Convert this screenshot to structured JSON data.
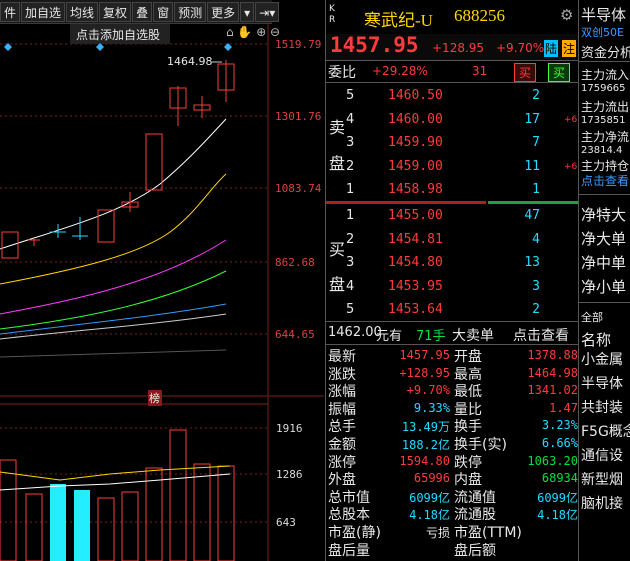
{
  "toolbar": {
    "items": [
      "件",
      "加自选",
      "均线",
      "复权",
      "叠",
      "窗",
      "预测",
      "更多"
    ],
    "tooltip": "点击添加自选股"
  },
  "chart": {
    "price_ticks": [
      "1519.79",
      "1301.76",
      "1083.74",
      "862.68",
      "644.65"
    ],
    "high_label": "1464.98",
    "vol_ticks": [
      "1916",
      "1286",
      "643"
    ],
    "marker": "榜"
  },
  "stock": {
    "kr": "K R",
    "name": "寒武纪-U",
    "code": "688256",
    "price": "1457.95",
    "change": "+128.95",
    "change_pct": "+9.70%",
    "exchange_badge": "陆",
    "note_badge": "注"
  },
  "ratio": {
    "label": "委比",
    "value": "+29.28%",
    "diff": "31",
    "buy_btn": "买",
    "sell_btn": "买"
  },
  "ask": {
    "side_label": [
      "卖",
      "盘"
    ],
    "rows": [
      {
        "lvl": "5",
        "price": "1460.50",
        "vol": "2",
        "chg": ""
      },
      {
        "lvl": "4",
        "price": "1460.00",
        "vol": "17",
        "chg": "+6"
      },
      {
        "lvl": "3",
        "price": "1459.90",
        "vol": "7",
        "chg": ""
      },
      {
        "lvl": "2",
        "price": "1459.00",
        "vol": "11",
        "chg": "+6"
      },
      {
        "lvl": "1",
        "price": "1458.98",
        "vol": "1",
        "chg": ""
      }
    ]
  },
  "bid": {
    "side_label": [
      "买",
      "盘"
    ],
    "rows": [
      {
        "lvl": "1",
        "price": "1455.00",
        "vol": "47"
      },
      {
        "lvl": "2",
        "price": "1454.81",
        "vol": "4"
      },
      {
        "lvl": "3",
        "price": "1454.80",
        "vol": "13"
      },
      {
        "lvl": "4",
        "price": "1453.95",
        "vol": "3"
      },
      {
        "lvl": "5",
        "price": "1453.64",
        "vol": "2"
      }
    ]
  },
  "trade_bar": {
    "amount": "1462.00",
    "unit": "元有",
    "hands": "71手",
    "big": "大卖单",
    "click": "点击查看"
  },
  "stats": [
    {
      "l1": "最新",
      "v1": "1457.95",
      "c1": "r",
      "l2": "开盘",
      "v2": "1378.88",
      "c2": "r"
    },
    {
      "l1": "涨跌",
      "v1": "+128.95",
      "c1": "r",
      "l2": "最高",
      "v2": "1464.98",
      "c2": "r"
    },
    {
      "l1": "涨幅",
      "v1": "+9.70%",
      "c1": "r",
      "l2": "最低",
      "v2": "1341.02",
      "c2": "r"
    },
    {
      "l1": "振幅",
      "v1": "9.33%",
      "c1": "c",
      "l2": "量比",
      "v2": "1.47",
      "c2": "r"
    },
    {
      "l1": "总手",
      "v1": "13.49万",
      "c1": "c",
      "l2": "换手",
      "v2": "3.23%",
      "c2": "c"
    },
    {
      "l1": "金额",
      "v1": "188.2亿",
      "c1": "c",
      "l2": "换手(实)",
      "v2": "6.66%",
      "c2": "c"
    },
    {
      "l1": "涨停",
      "v1": "1594.80",
      "c1": "r",
      "l2": "跌停",
      "v2": "1063.20",
      "c2": "g"
    },
    {
      "l1": "外盘",
      "v1": "65996",
      "c1": "r",
      "l2": "内盘",
      "v2": "68934",
      "c2": "g"
    },
    {
      "l1": "总市值",
      "v1": "6099亿",
      "c1": "c",
      "l2": "流通值",
      "v2": "6099亿",
      "c2": "c"
    },
    {
      "l1": "总股本",
      "v1": "4.18亿",
      "c1": "c",
      "l2": "流通股",
      "v2": "4.18亿",
      "c2": "c"
    },
    {
      "l1": "市盈(静)",
      "v1": "亏损",
      "c1": "w",
      "l2": "市盈(TTM)",
      "v2": "",
      "c2": "w"
    },
    {
      "l1": "盘后量",
      "v1": "",
      "c1": "w",
      "l2": "盘后额",
      "v2": "",
      "c2": "w"
    }
  ],
  "side": {
    "sector": "半导体",
    "tag": "双创50E",
    "flow_title": "资金分析",
    "flows": [
      {
        "label": "主力流入",
        "value": "1759665"
      },
      {
        "label": "主力流出",
        "value": "1735851"
      },
      {
        "label": "主力净流",
        "value": "23814.4"
      },
      {
        "label": "主力持仓",
        "value": "点击查看"
      }
    ],
    "items": [
      "净特大",
      "净大单",
      "净中单",
      "净小单"
    ],
    "all_label": "全部",
    "name_header": "名称",
    "sectors": [
      "小金属",
      "半导体",
      "共封装",
      "F5G概念",
      "通信设",
      "新型烟",
      "脑机接"
    ]
  }
}
